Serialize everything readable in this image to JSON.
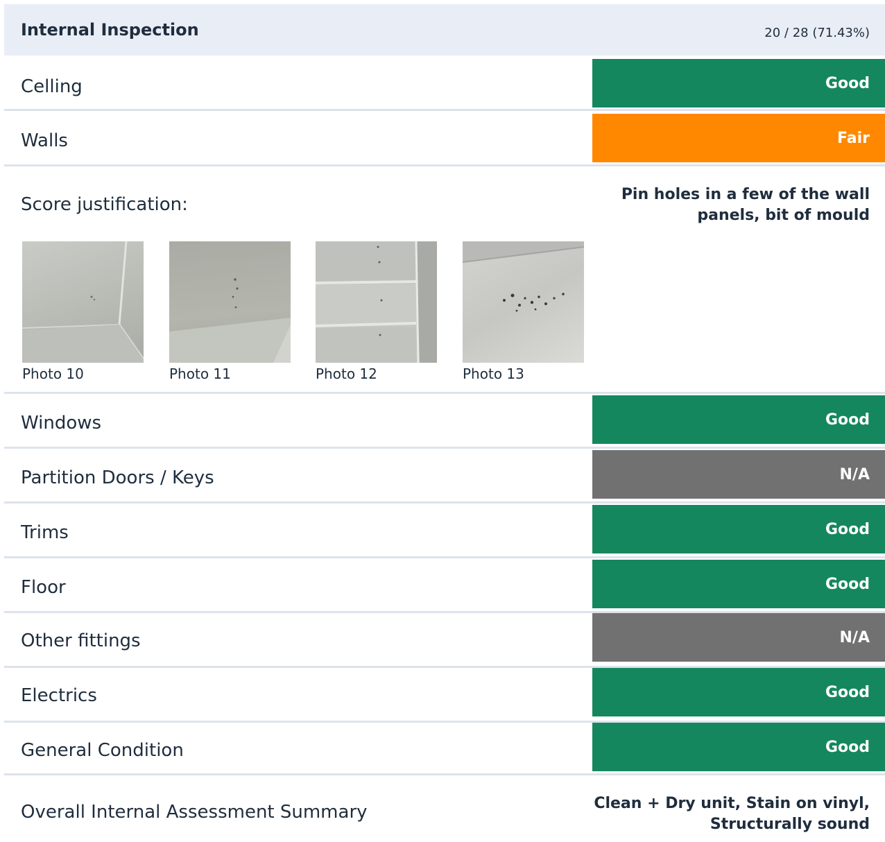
{
  "section": {
    "title": "Internal Inspection",
    "score": "20 / 28 (71.43%)"
  },
  "colors": {
    "good": "#15875f",
    "fair": "#ff8800",
    "na": "#717171"
  },
  "items": [
    {
      "label": "Celling",
      "rating": "Good"
    },
    {
      "label": "Walls",
      "rating": "Fair"
    },
    {
      "label": "Windows",
      "rating": "Good"
    },
    {
      "label": "Partition Doors / Keys",
      "rating": "N/A"
    },
    {
      "label": "Trims",
      "rating": "Good"
    },
    {
      "label": "Floor",
      "rating": "Good"
    },
    {
      "label": "Other fittings",
      "rating": "N/A"
    },
    {
      "label": "Electrics",
      "rating": "Good"
    },
    {
      "label": "General Condition",
      "rating": "Good"
    }
  ],
  "justification": {
    "label": "Score justification:",
    "text_line1": "Pin holes in a few of the wall",
    "text_line2": "panels, bit of mould"
  },
  "photos": [
    {
      "caption": "Photo 10"
    },
    {
      "caption": "Photo 11"
    },
    {
      "caption": "Photo 12"
    },
    {
      "caption": "Photo 13"
    }
  ],
  "summary": {
    "label": "Overall Internal Assessment Summary",
    "text_line1": "Clean + Dry unit, Stain on vinyl,",
    "text_line2": "Structurally sound"
  }
}
